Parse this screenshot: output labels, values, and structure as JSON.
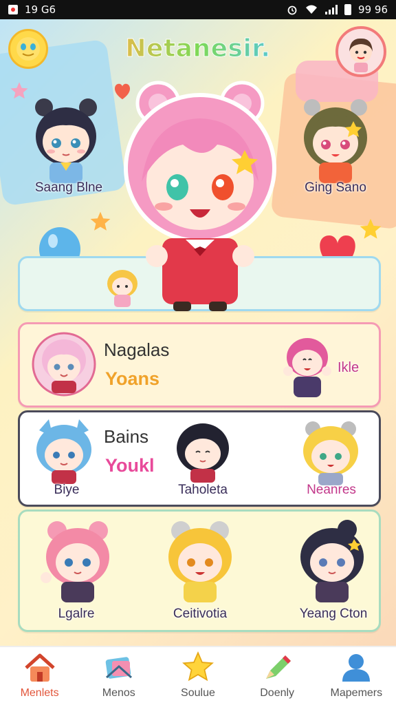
{
  "status_bar": {
    "time": "19 G6",
    "battery_text": "99 96"
  },
  "app": {
    "title": "Netanesir."
  },
  "featured": {
    "left_label": "Saang Blne",
    "right_label": "Ging Sano"
  },
  "rows": [
    {
      "title": "Nagalas",
      "subtitle": "Yoans",
      "right_label": "Ikle"
    },
    {
      "title": "Bains",
      "subtitle": "Youkl",
      "left_label": "Biye",
      "middle_label": "Taholeta",
      "right_label": "Neanres"
    },
    {
      "left_label": "Lgalre",
      "middle_label": "Ceitivotia",
      "right_label": "Yeang Cton"
    }
  ],
  "nav": {
    "items": [
      {
        "label": "Menlets",
        "icon": "home-icon"
      },
      {
        "label": "Menos",
        "icon": "card-icon"
      },
      {
        "label": "Soulue",
        "icon": "star-icon"
      },
      {
        "label": "Doenly",
        "icon": "pencil-icon"
      },
      {
        "label": "Mapemers",
        "icon": "user-icon"
      }
    ],
    "active_index": 0
  },
  "colors": {
    "accent_orange": "#e2553a",
    "row1_border": "#f59ab4",
    "row2_border": "#4a4a5a",
    "row3_border": "#a8dcbf",
    "row1_sub": "#f0a22a",
    "row2_sub": "#e84a9a",
    "right_label_pink": "#c2378a"
  }
}
